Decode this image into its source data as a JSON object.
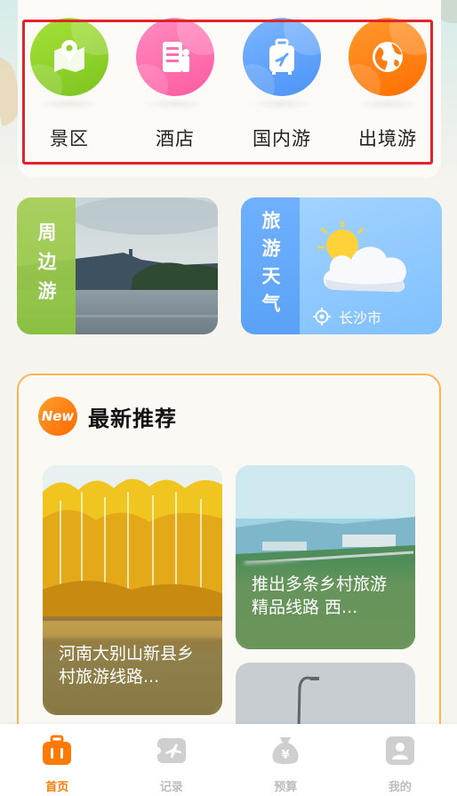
{
  "categories": [
    {
      "label": "景区",
      "icon": "map-pin-icon",
      "color": "#8fd12e"
    },
    {
      "label": "酒店",
      "icon": "hotel-icon",
      "color": "#ff6fae"
    },
    {
      "label": "国内游",
      "icon": "luggage-icon",
      "color": "#5fa4ff"
    },
    {
      "label": "出境游",
      "icon": "globe-icon",
      "color": "#ff7d14"
    }
  ],
  "nearby": {
    "label": "周边游"
  },
  "weather": {
    "label": "旅游天气",
    "city": "长沙市"
  },
  "recommend": {
    "badge": "New",
    "title": "最新推荐",
    "items": [
      {
        "caption": "河南大别山新县乡村旅游线路..."
      },
      {
        "caption": "推出多条乡村旅游精品线路 西..."
      }
    ]
  },
  "tabbar": {
    "items": [
      {
        "label": "首页",
        "icon": "suitcase-icon",
        "active": true
      },
      {
        "label": "记录",
        "icon": "plane-ticket-icon",
        "active": false
      },
      {
        "label": "预算",
        "icon": "money-bag-icon",
        "active": false
      },
      {
        "label": "我的",
        "icon": "user-icon",
        "active": false
      }
    ]
  },
  "colors": {
    "accent": "#ff7a00",
    "highlight_frame": "#e0242a",
    "section_border": "#ffb45a"
  }
}
